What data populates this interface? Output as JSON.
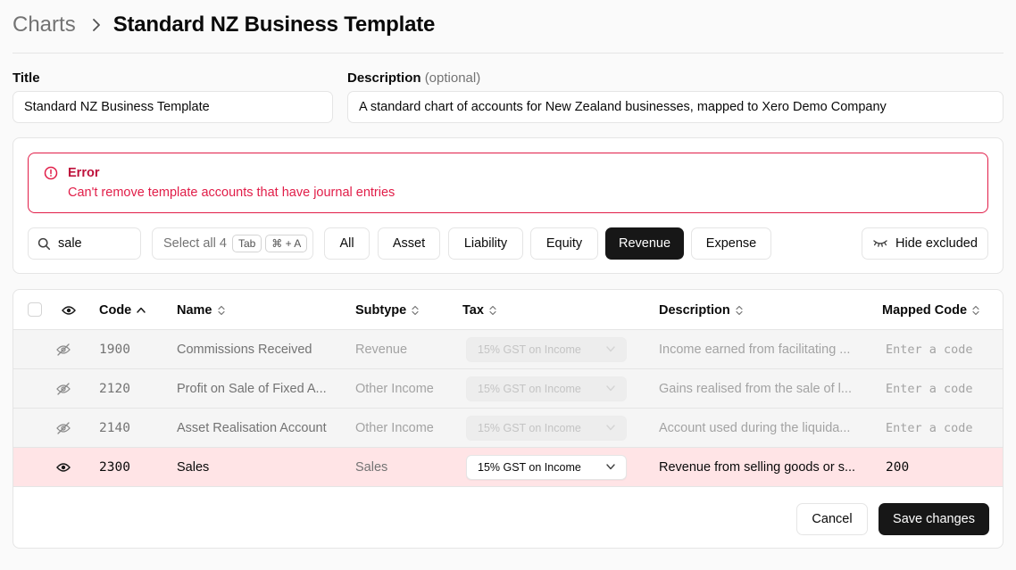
{
  "breadcrumb": {
    "parent": "Charts",
    "current": "Standard NZ Business Template"
  },
  "form": {
    "title_label": "Title",
    "title_value": "Standard NZ Business Template",
    "description_label": "Description",
    "description_optional": "(optional)",
    "description_value": "A standard chart of accounts for New Zealand businesses, mapped to Xero Demo Company"
  },
  "alert": {
    "title": "Error",
    "message": "Can't remove template accounts that have journal entries",
    "color": "#e11d48"
  },
  "filters": {
    "search_value": "sale",
    "select_all_label": "Select all 4",
    "kbd_tab": "Tab",
    "kbd_cmd": "⌘ + A",
    "types": [
      "All",
      "Asset",
      "Liability",
      "Equity",
      "Revenue",
      "Expense"
    ],
    "active_type": "Revenue",
    "hide_excluded_label": "Hide excluded"
  },
  "table": {
    "columns": {
      "code": "Code",
      "name": "Name",
      "subtype": "Subtype",
      "tax": "Tax",
      "description": "Description",
      "mapped": "Mapped Code"
    },
    "mapped_placeholder": "Enter a code",
    "rows": [
      {
        "code": "1900",
        "name": "Commissions Received",
        "subtype": "Revenue",
        "tax": "15% GST on Income",
        "description": "Income earned from facilitating ...",
        "mapped": "",
        "excluded": true
      },
      {
        "code": "2120",
        "name": "Profit on Sale of Fixed A...",
        "subtype": "Other Income",
        "tax": "15% GST on Income",
        "description": "Gains realised from the sale of l...",
        "mapped": "",
        "excluded": true
      },
      {
        "code": "2140",
        "name": "Asset Realisation Account",
        "subtype": "Other Income",
        "tax": "15% GST on Income",
        "description": "Account used during the liquida...",
        "mapped": "",
        "excluded": true
      },
      {
        "code": "2300",
        "name": "Sales",
        "subtype": "Sales",
        "tax": "15% GST on Income",
        "description": "Revenue from selling goods or s...",
        "mapped": "200",
        "excluded": false
      }
    ]
  },
  "actions": {
    "cancel": "Cancel",
    "save": "Save changes"
  }
}
